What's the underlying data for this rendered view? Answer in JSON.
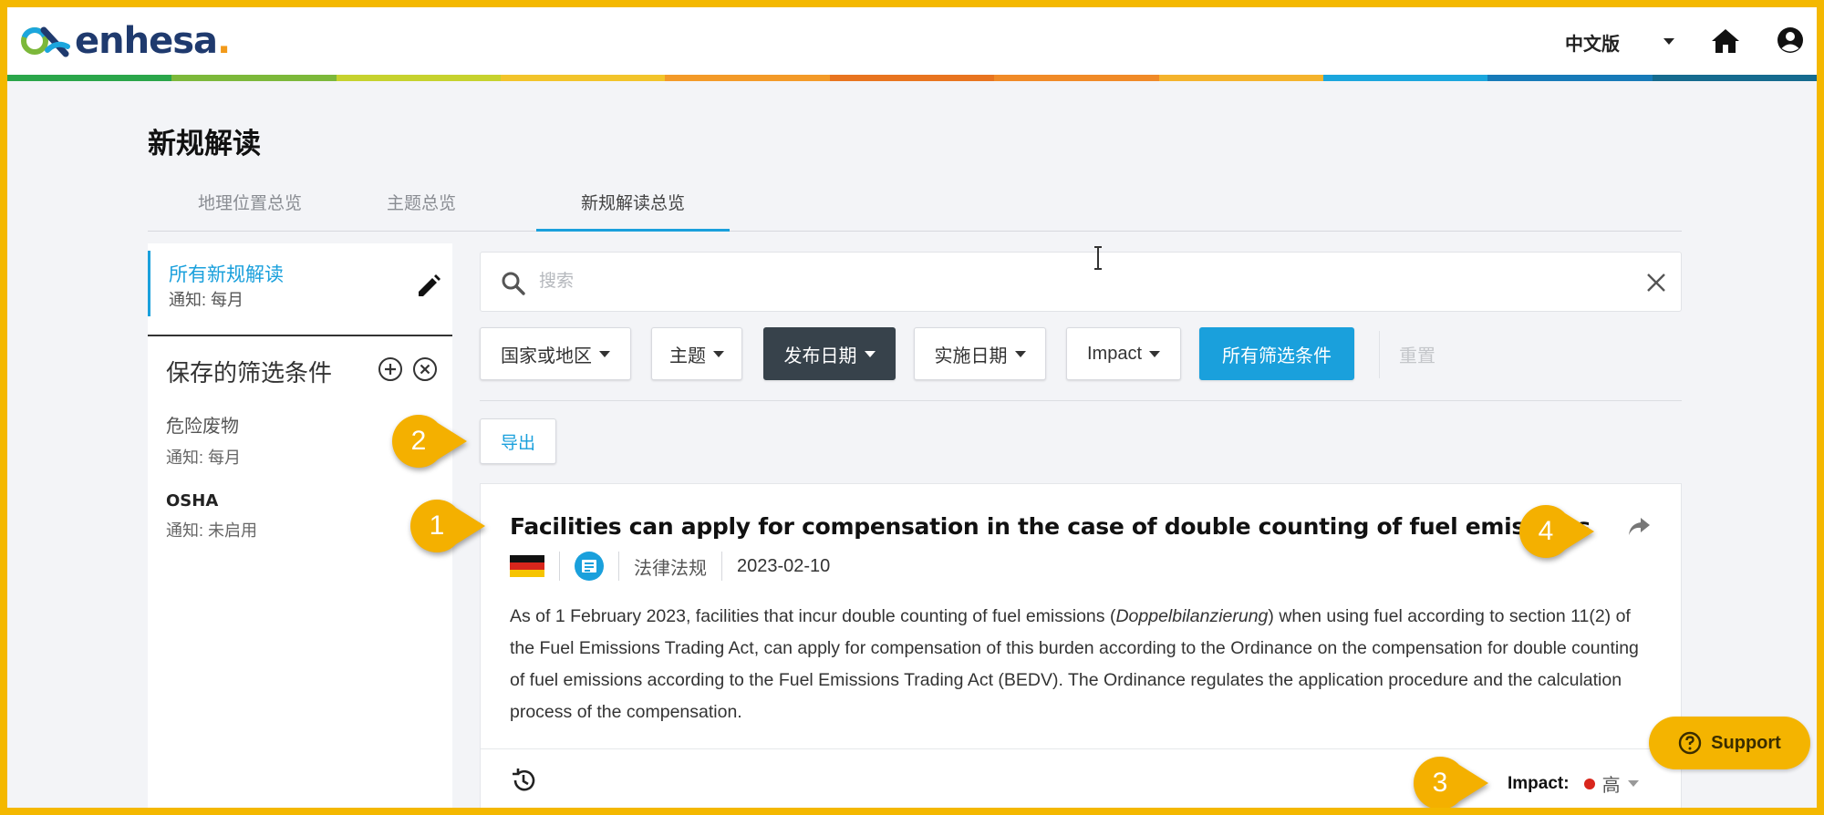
{
  "header": {
    "logo_text": "enhesa",
    "logo_dot": ".",
    "language": "中文版",
    "colors": {
      "brand_blue": "#1aa0dc",
      "frame": "#f4b800",
      "rainbow": [
        "#2aa64a",
        "#7cb83a",
        "#c6d22e",
        "#f2c42a",
        "#f39a28",
        "#e8741f",
        "#f08a27",
        "#f4b32c",
        "#1ba6dd",
        "#177ab8",
        "#156b8f"
      ]
    }
  },
  "page": {
    "title": "新规解读",
    "tabs": [
      {
        "label": "地理位置总览"
      },
      {
        "label": "主题总览"
      },
      {
        "label": "新规解读总览"
      }
    ]
  },
  "sidebar": {
    "all_news": {
      "label": "所有新规解读",
      "notif": "通知: 每月"
    },
    "saved_title": "保存的筛选条件",
    "saved": [
      {
        "name": "危险废物",
        "notif": "通知: 每月"
      },
      {
        "name": "OSHA",
        "notif": "通知: 未启用"
      }
    ]
  },
  "search": {
    "placeholder": "搜索",
    "value": ""
  },
  "filters": {
    "items": [
      {
        "label": "国家或地区"
      },
      {
        "label": "主题"
      },
      {
        "label": "发布日期"
      },
      {
        "label": "实施日期"
      },
      {
        "label": "Impact"
      }
    ],
    "all_filters": "所有筛选条件",
    "reset": "重置"
  },
  "export_label": "导出",
  "card": {
    "title": "Facilities can apply for compensation in the case of double counting of fuel emissions",
    "category": "法律法规",
    "date": "2023-02-10",
    "body_pre": "As of 1 February 2023, facilities that incur double counting of fuel emissions (",
    "body_italic": "Doppelbilanzierung",
    "body_post": ") when using fuel according to section 11(2) of the Fuel Emissions Trading Act, can apply for compensation of this burden according to the Ordinance on the compensation for double counting of fuel emissions according to the Fuel Emissions Trading Act (BEDV). The Ordinance regulates the application procedure and the calculation process of the compensation.",
    "impact_label": "Impact:",
    "impact_value": "高",
    "impact_color": "#d9261c"
  },
  "callouts": [
    "1",
    "2",
    "3",
    "4"
  ],
  "support_label": "Support"
}
